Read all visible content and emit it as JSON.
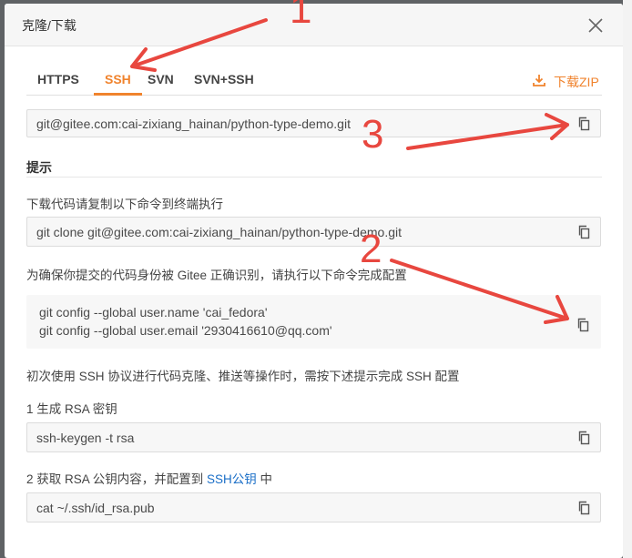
{
  "dialog": {
    "title": "克隆/下载"
  },
  "tabs": [
    "HTTPS",
    "SSH",
    "SVN",
    "SVN+SSH"
  ],
  "active_tab": "SSH",
  "download_zip_label": "下载ZIP",
  "repo_url": "git@gitee.com:cai-zixiang_hainan/python-type-demo.git",
  "tips": {
    "title": "提示",
    "download_hint": "下载代码请复制以下命令到终端执行",
    "clone_cmd": "git clone git@gitee.com:cai-zixiang_hainan/python-type-demo.git",
    "identity_hint": "为确保你提交的代码身份被 Gitee 正确识别，请执行以下命令完成配置",
    "config_line1": "git config --global user.name 'cai_fedora'",
    "config_line2": "git config --global user.email '2930416610@qq.com'",
    "ssh_first_hint": "初次使用 SSH 协议进行代码克隆、推送等操作时，需按下述提示完成 SSH 配置",
    "step1_label": "1 生成 RSA 密钥",
    "step1_cmd": "ssh-keygen -t rsa",
    "step2_prefix": "2 获取 RSA 公钥内容，并配置到 ",
    "step2_link": "SSH公钥",
    "step2_suffix": " 中",
    "step2_cmd": "cat ~/.ssh/id_rsa.pub"
  },
  "annotations": {
    "n1": "1",
    "n2": "2",
    "n3": "3",
    "color": "#e8473f"
  },
  "colors": {
    "accent": "#f0832d",
    "link": "#1a6ec7"
  }
}
